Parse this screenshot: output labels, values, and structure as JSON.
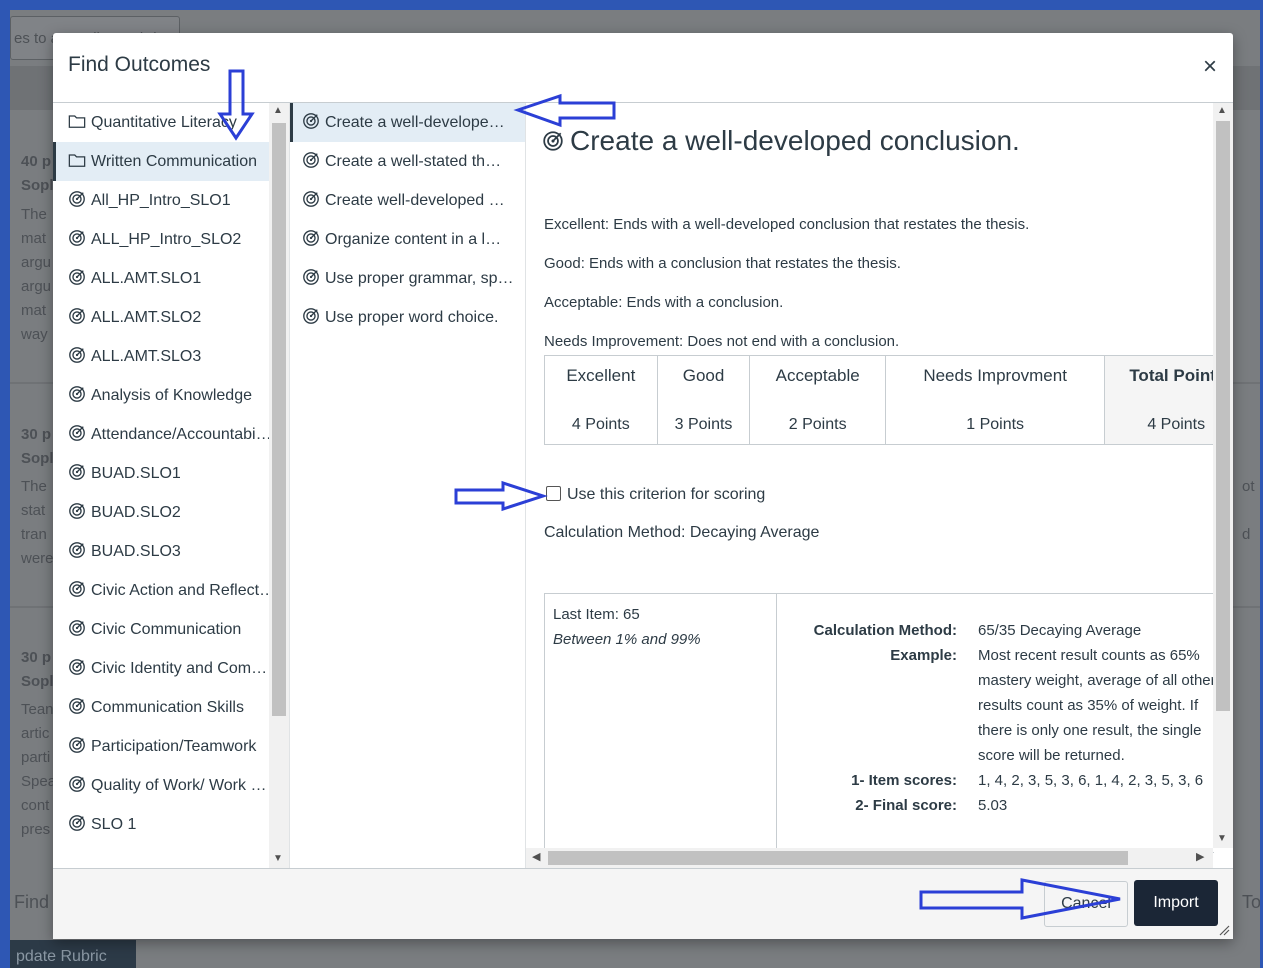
{
  "background": {
    "top_text": "es to a Grading Rubric",
    "rows": [
      {
        "points": "40 p",
        "name": "Sopl",
        "lines": [
          "The",
          "mat",
          "argu",
          "argu",
          "mat",
          "way"
        ]
      },
      {
        "points": "30 p",
        "name": "Sopl",
        "lines": [
          "The",
          "stat",
          "tran",
          "were"
        ]
      },
      {
        "points": "30 p",
        "name": "Sopl",
        "lines": [
          "Tean",
          "artic",
          "parti",
          "Spea",
          "cont",
          "pres"
        ]
      }
    ],
    "right_fragments": [
      "ot",
      "d"
    ],
    "find_label": "Find",
    "to_label": "To",
    "update_button": "pdate Rubric"
  },
  "modal": {
    "title": "Find Outcomes",
    "close_symbol": "×"
  },
  "groups": [
    {
      "label": "Quantitative Literacy",
      "icon": "folder-icon"
    },
    {
      "label": "Written Communication",
      "icon": "folder-icon",
      "active": true
    },
    {
      "label": "All_HP_Intro_SLO1",
      "icon": "outcome-target-icon"
    },
    {
      "label": "ALL_HP_Intro_SLO2",
      "icon": "outcome-target-icon"
    },
    {
      "label": "ALL.AMT.SLO1",
      "icon": "outcome-target-icon"
    },
    {
      "label": "ALL.AMT.SLO2",
      "icon": "outcome-target-icon"
    },
    {
      "label": "ALL.AMT.SLO3",
      "icon": "outcome-target-icon"
    },
    {
      "label": "Analysis of Knowledge",
      "icon": "outcome-target-icon"
    },
    {
      "label": "Attendance/Accountabi…",
      "icon": "outcome-target-icon"
    },
    {
      "label": "BUAD.SLO1",
      "icon": "outcome-target-icon"
    },
    {
      "label": "BUAD.SLO2",
      "icon": "outcome-target-icon"
    },
    {
      "label": "BUAD.SLO3",
      "icon": "outcome-target-icon"
    },
    {
      "label": "Civic Action and Reflect…",
      "icon": "outcome-target-icon"
    },
    {
      "label": "Civic Communication",
      "icon": "outcome-target-icon"
    },
    {
      "label": "Civic Identity and Com…",
      "icon": "outcome-target-icon"
    },
    {
      "label": "Communication Skills",
      "icon": "outcome-target-icon"
    },
    {
      "label": "Participation/Teamwork",
      "icon": "outcome-target-icon"
    },
    {
      "label": "Quality of Work/ Work …",
      "icon": "outcome-target-icon"
    },
    {
      "label": "SLO 1",
      "icon": "outcome-target-icon"
    }
  ],
  "outcomes": [
    {
      "label": "Create a well-develope…",
      "active": true
    },
    {
      "label": "Create a well-stated th…"
    },
    {
      "label": "Create well-developed …"
    },
    {
      "label": "Organize content in a l…"
    },
    {
      "label": "Use proper grammar, sp…"
    },
    {
      "label": "Use proper word choice."
    }
  ],
  "detail": {
    "title": "Create a well-developed conclusion.",
    "descriptions": [
      "Excellent: Ends with a well-developed conclusion that restates the thesis.",
      "Good: Ends with a conclusion that restates the thesis.",
      "Acceptable: Ends with a conclusion.",
      "Needs Improvement: Does not end with a conclusion."
    ],
    "ratings": [
      {
        "name": "Excellent",
        "points": "4 Points"
      },
      {
        "name": "Good",
        "points": "3 Points"
      },
      {
        "name": "Acceptable",
        "points": "2 Points"
      },
      {
        "name": "Needs Improvment",
        "points": "1 Points"
      },
      {
        "name": "Total Points",
        "points": "4 Points",
        "total": true
      }
    ],
    "criterion_label": "Use this criterion for scoring",
    "criterion_checked": false,
    "calculation_line": "Calculation Method: Decaying Average",
    "calc_box": {
      "last_item": "Last Item: 65",
      "range": "Between 1% and 99%",
      "method_key": "Calculation Method:",
      "method_value": "65/35 Decaying Average",
      "example_key": "Example:",
      "example_lines": [
        "Most recent result counts as 65%",
        "mastery weight, average of all other",
        "results count as 35% of weight. If",
        "there is only one result, the single",
        "score will be returned."
      ],
      "item_scores_key": "1- Item scores:",
      "item_scores_value": "1, 4, 2, 3, 5, 3, 6, 1, 4, 2, 3, 5, 3, 6",
      "final_score_key": "2- Final score:",
      "final_score_value": "5.03"
    }
  },
  "footer": {
    "cancel_label": "Cancel",
    "import_label": "Import"
  },
  "colors": {
    "annotation_arrow": "#2b3fd6",
    "import_button": "#1b2636",
    "active_item": "#e3edf5"
  }
}
